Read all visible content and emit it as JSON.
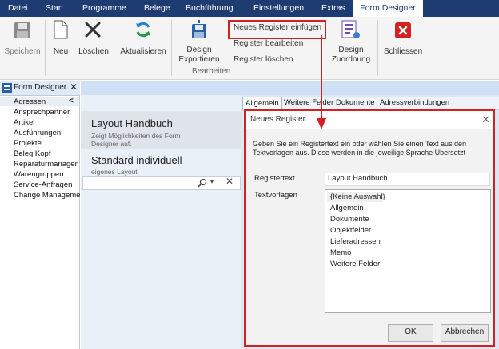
{
  "menu": {
    "items": [
      {
        "label": "Datei"
      },
      {
        "label": "Start"
      },
      {
        "label": "Programme"
      },
      {
        "label": "Belege"
      },
      {
        "label": "Buchführung"
      },
      {
        "label": "Einstellungen"
      },
      {
        "label": "Extras"
      },
      {
        "label": "Form Designer"
      }
    ]
  },
  "ribbon": {
    "save_label": "Speichern",
    "new_label": "Neu",
    "delete_label": "Löschen",
    "refresh_label": "Aktualisieren",
    "export_label_1": "Design",
    "export_label_2": "Exportieren",
    "add_register_label": "Neues Register einfügen",
    "edit_register_label": "Register bearbeiten",
    "delete_register_label": "Register löschen",
    "assign_label_1": "Design",
    "assign_label_2": "Zuordnung",
    "close_label": "Schliessen",
    "group_label": "Bearbeiten"
  },
  "left_panel": {
    "title": "Form Designer",
    "collapse_glyph": "<",
    "items": [
      {
        "label": "Adressen"
      },
      {
        "label": "Ansprechpartner"
      },
      {
        "label": "Artikel"
      },
      {
        "label": "Ausführungen"
      },
      {
        "label": "Projekte"
      },
      {
        "label": "Beleg Kopf"
      },
      {
        "label": "Reparaturmanager"
      },
      {
        "label": "Warengruppen"
      },
      {
        "label": "Service-Anfragen"
      },
      {
        "label": "Change Managemer"
      }
    ]
  },
  "layouts": [
    {
      "title": "Layout Handbuch",
      "subtitle": "Zeigt Möglichkeiten des Form Designer auf."
    },
    {
      "title": "Standard individuell",
      "subtitle": "eigenes Layout"
    }
  ],
  "tabs": [
    {
      "label": "Allgemein"
    },
    {
      "label": "Weitere Felder"
    },
    {
      "label": "Dokumente"
    },
    {
      "label": "Adressverbindungen"
    }
  ],
  "dialog": {
    "title": "Neues Register",
    "description": "Geben Sie ein Registertext ein oder wählen Sie einen Text aus den Textvorlagen aus. Diese werden in die jeweilige Sprache Übersetzt",
    "registertext_label": "Registertext",
    "registertext_value": "Layout Handbuch",
    "textvorlagen_label": "Textvorlagen",
    "templates": [
      {
        "label": "{Keine Auswahl}"
      },
      {
        "label": "Allgemein"
      },
      {
        "label": "Dokumente"
      },
      {
        "label": "Objektfelder"
      },
      {
        "label": "Lieferadressen"
      },
      {
        "label": "Memo"
      },
      {
        "label": "Weitere Felder"
      }
    ],
    "ok_label": "OK",
    "cancel_label": "Abbrechen"
  },
  "colors": {
    "menubar": "#1e3c72",
    "highlight_red": "#d42020",
    "panel_blue": "#dce7f4"
  }
}
